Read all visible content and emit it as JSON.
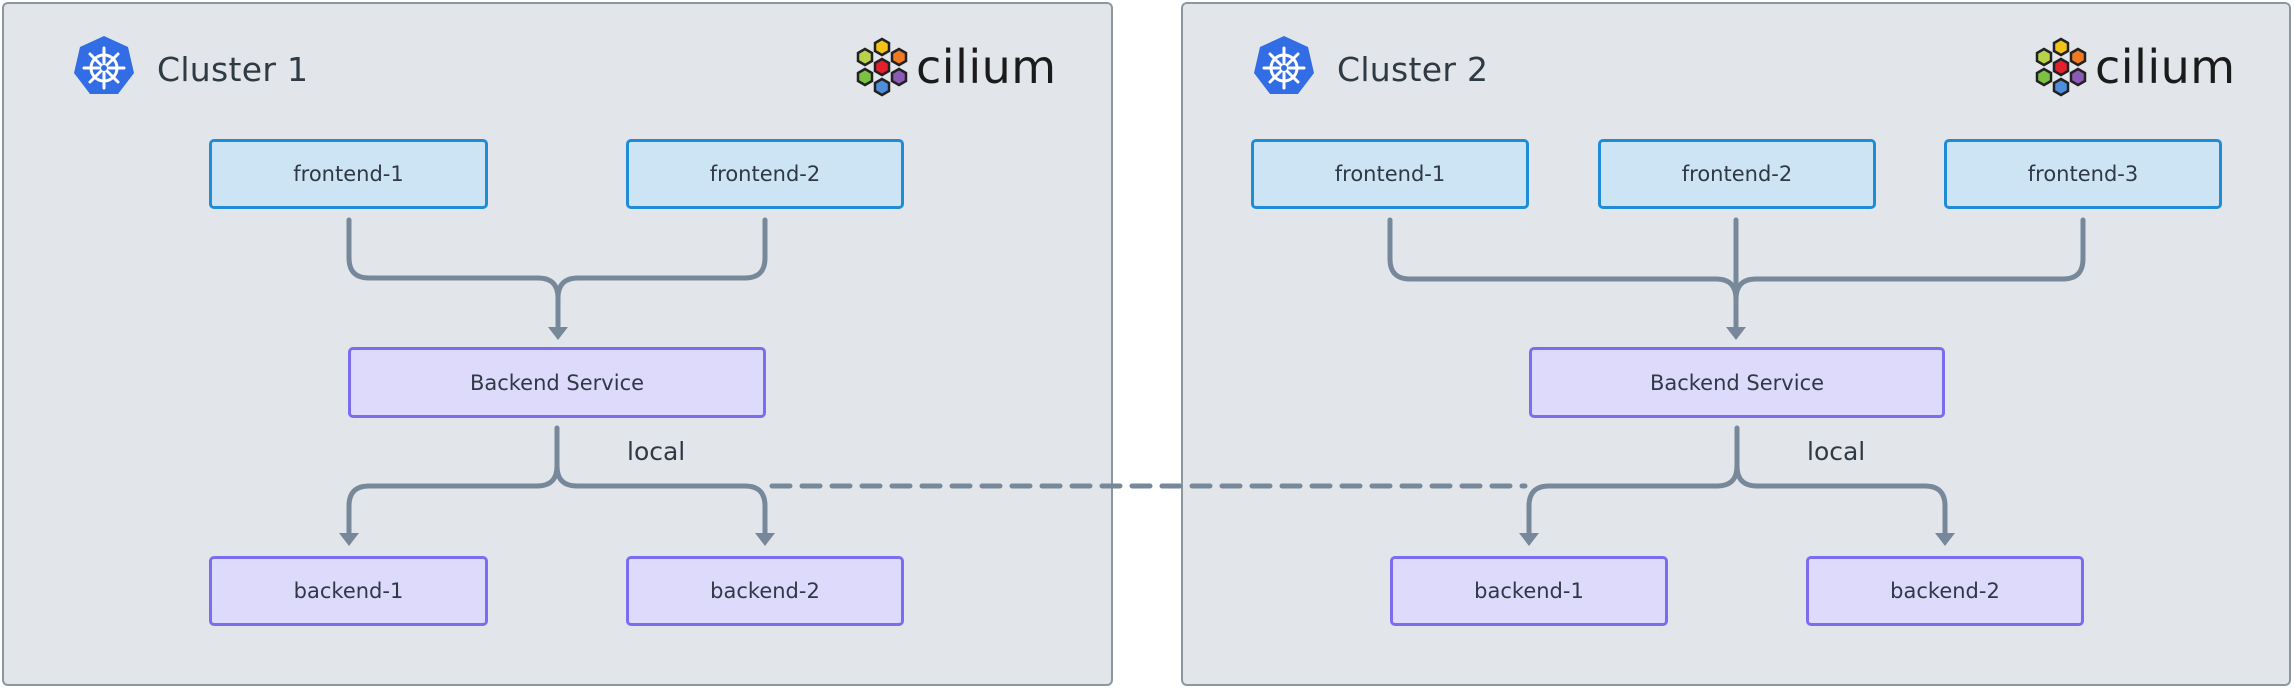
{
  "clusters": [
    {
      "title": "Cluster 1",
      "brand": "cilium",
      "frontends": [
        "frontend-1",
        "frontend-2"
      ],
      "service": "Backend Service",
      "route_label": "local",
      "backends": [
        "backend-1",
        "backend-2"
      ]
    },
    {
      "title": "Cluster 2",
      "brand": "cilium",
      "frontends": [
        "frontend-1",
        "frontend-2",
        "frontend-3"
      ],
      "service": "Backend Service",
      "route_label": "local",
      "backends": [
        "backend-1",
        "backend-2"
      ]
    }
  ],
  "edges": [
    {
      "from": "Cluster 1 / frontend-1",
      "to": "Cluster 1 / Backend Service",
      "style": "solid"
    },
    {
      "from": "Cluster 1 / frontend-2",
      "to": "Cluster 1 / Backend Service",
      "style": "solid"
    },
    {
      "from": "Cluster 1 / Backend Service",
      "to": "Cluster 1 / backend-1",
      "style": "solid"
    },
    {
      "from": "Cluster 1 / Backend Service",
      "to": "Cluster 1 / backend-2",
      "style": "solid"
    },
    {
      "from": "Cluster 2 / frontend-1",
      "to": "Cluster 2 / Backend Service",
      "style": "solid"
    },
    {
      "from": "Cluster 2 / frontend-2",
      "to": "Cluster 2 / Backend Service",
      "style": "solid"
    },
    {
      "from": "Cluster 2 / frontend-3",
      "to": "Cluster 2 / Backend Service",
      "style": "solid"
    },
    {
      "from": "Cluster 2 / Backend Service",
      "to": "Cluster 2 / backend-1",
      "style": "solid"
    },
    {
      "from": "Cluster 2 / Backend Service",
      "to": "Cluster 2 / backend-2",
      "style": "solid"
    },
    {
      "from": "Cluster 1 / Backend Service",
      "to": "Cluster 2 / backend-1",
      "style": "dashed"
    },
    {
      "from": "Cluster 2 / Backend Service",
      "to": "Cluster 1 / backend-2",
      "style": "dashed"
    }
  ],
  "colors": {
    "cluster_fill": "#e2e6ea",
    "cluster_border": "#8d979f",
    "frontend_fill": "#cde4f5",
    "frontend_border": "#1f8dd6",
    "backend_fill": "#dedafb",
    "backend_border": "#7c6cf0",
    "connector": "#77889a",
    "kubernetes_blue": "#326de6"
  },
  "icons": {
    "cluster": "kubernetes-helm-icon",
    "brand": "cilium-hexagon-logo"
  }
}
